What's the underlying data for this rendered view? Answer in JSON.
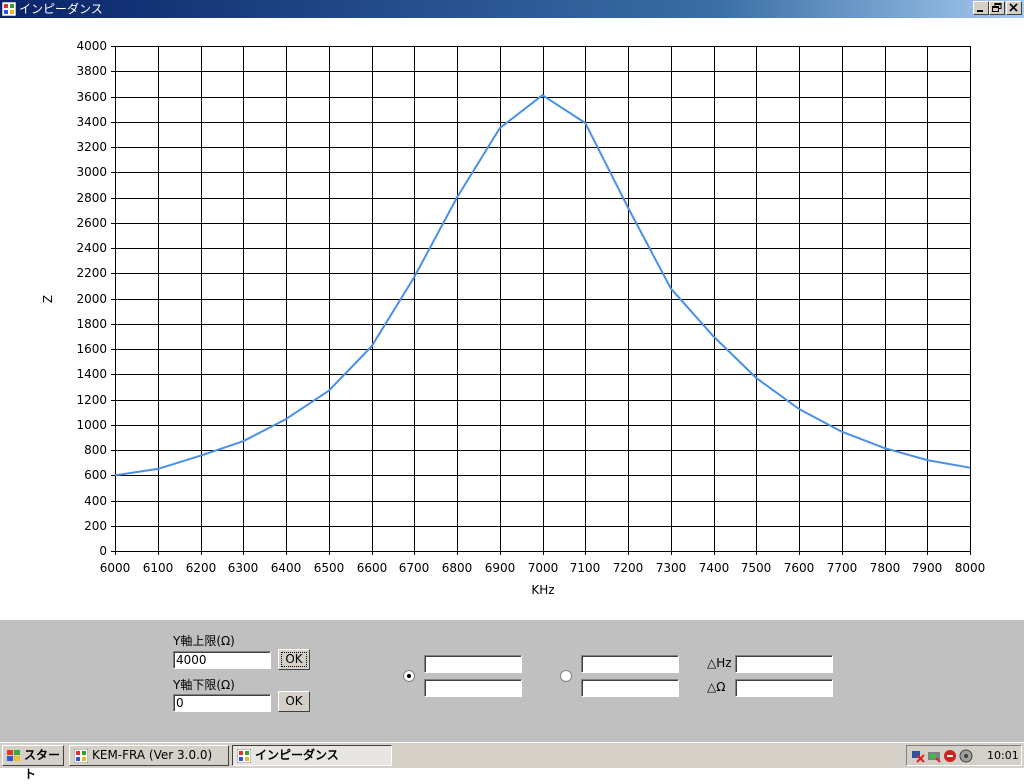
{
  "window": {
    "title": "インピーダンス"
  },
  "chart_data": {
    "type": "line",
    "title": "",
    "xlabel": "KHz",
    "ylabel": "Z",
    "xlim": [
      6000,
      8000
    ],
    "ylim": [
      0,
      4000
    ],
    "grid": true,
    "x_ticks": [
      6000,
      6100,
      6200,
      6300,
      6400,
      6500,
      6600,
      6700,
      6800,
      6900,
      7000,
      7100,
      7200,
      7300,
      7400,
      7500,
      7600,
      7700,
      7800,
      7900,
      8000
    ],
    "y_ticks": [
      0,
      200,
      400,
      600,
      800,
      1000,
      1200,
      1400,
      1600,
      1800,
      2000,
      2200,
      2400,
      2600,
      2800,
      3000,
      3200,
      3400,
      3600,
      3800,
      4000
    ],
    "series": [
      {
        "color": "#4a8fe8",
        "x": [
          6000,
          6100,
          6200,
          6300,
          6400,
          6500,
          6600,
          6700,
          6800,
          6900,
          7000,
          7100,
          7200,
          7300,
          7400,
          7500,
          7600,
          7700,
          7800,
          7900,
          8000
        ],
        "y": [
          600,
          650,
          755,
          870,
          1045,
          1270,
          1620,
          2170,
          2800,
          3350,
          3610,
          3390,
          2720,
          2080,
          1700,
          1370,
          1125,
          945,
          815,
          720,
          660
        ]
      }
    ]
  },
  "controls": {
    "y_upper_label": "Y軸上限(Ω)",
    "y_upper_value": "4000",
    "y_lower_label": "Y軸下限(Ω)",
    "y_lower_value": "0",
    "ok_label": "OK",
    "cursor1_selected": true,
    "cursor2_selected": false,
    "cursor1_freq": "",
    "cursor1_z": "",
    "cursor2_freq": "",
    "cursor2_z": "",
    "delta_hz_label": "△Hz",
    "delta_hz_value": "",
    "delta_ohm_label": "△Ω",
    "delta_ohm_value": ""
  },
  "taskbar": {
    "start_label": "スタート",
    "tasks": [
      {
        "label": "KEM-FRA (Ver 3.0.0)",
        "active": false
      },
      {
        "label": "インピーダンス",
        "active": true
      }
    ],
    "clock": "10:01"
  }
}
